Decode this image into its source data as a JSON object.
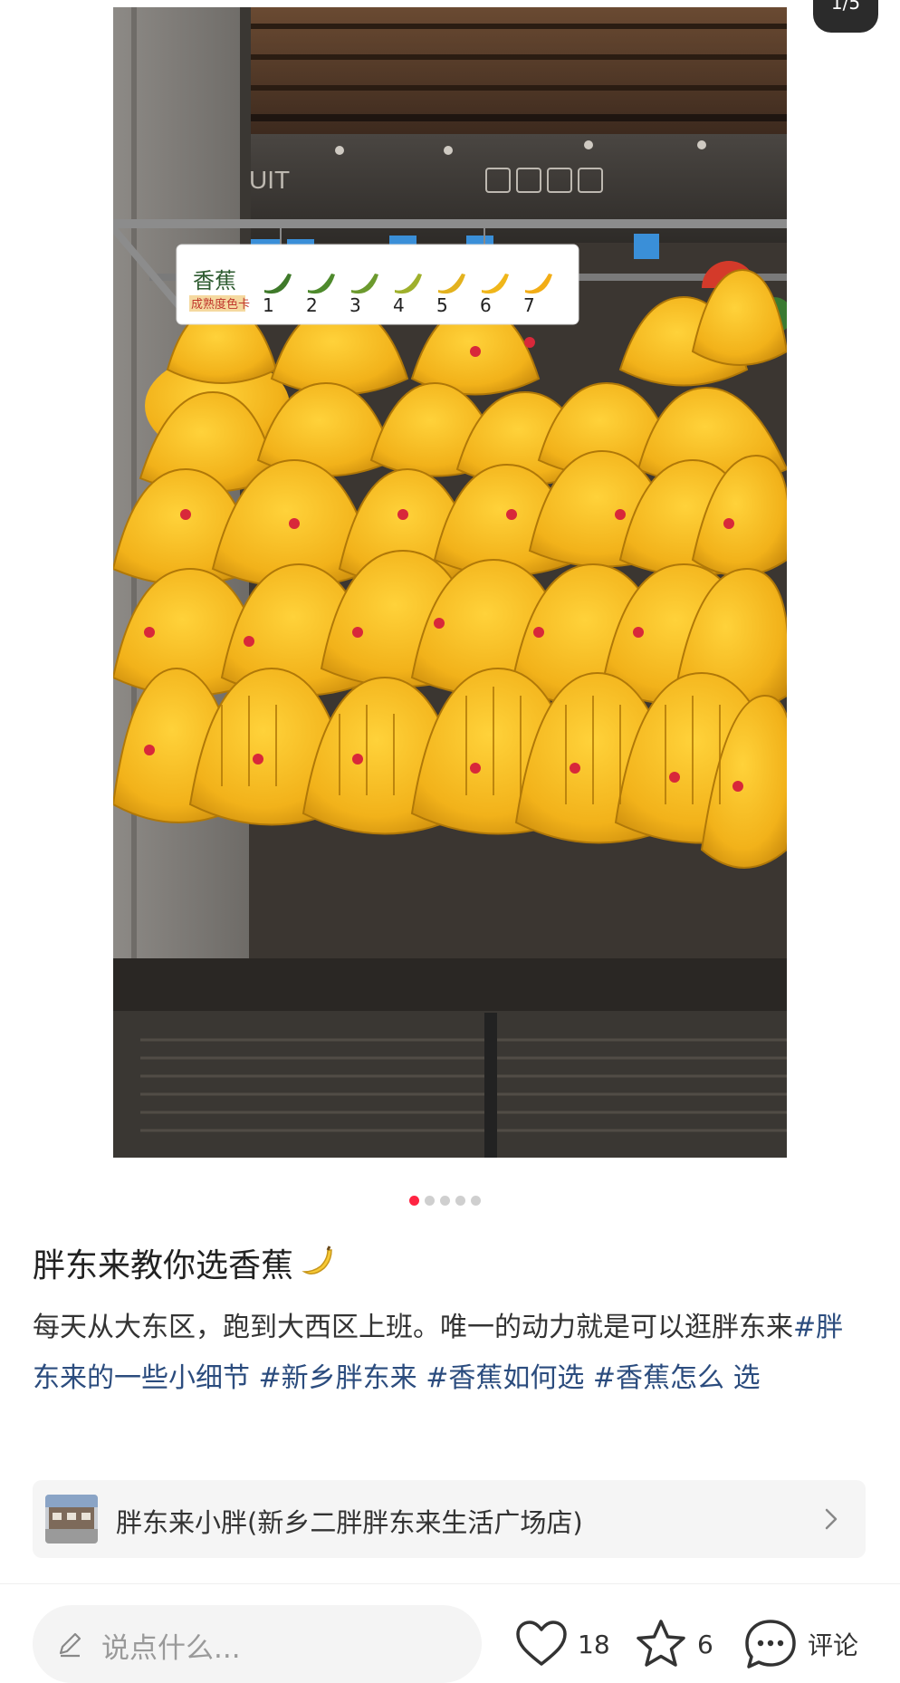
{
  "pager": {
    "counter": "1/5"
  },
  "post": {
    "title": "胖东来教你选香蕉",
    "desc_lead": "每天从大东区，跑到大西区上班。唯一的动力就是可以逛胖东来",
    "tags": [
      "#胖东来的一些小细节",
      "#新乡胖东来",
      "#香蕉如何选",
      "#香蕉怎么",
      "选"
    ]
  },
  "photo": {
    "sign_title": "香蕉",
    "sign_subtitle": "成熟度色卡",
    "stages": [
      "1",
      "2",
      "3",
      "4",
      "5",
      "6",
      "7"
    ],
    "bg_text": "UIT"
  },
  "carousel": {
    "count": 5,
    "active": 0
  },
  "location": {
    "text": "胖东来小胖(新乡二胖胖东来生活广场店)"
  },
  "bottom_bar": {
    "comment_placeholder": "说点什么...",
    "likes": "18",
    "stars": "6",
    "comment_label": "评论"
  },
  "colors": {
    "accent": "#ff2442",
    "tag": "#2b4c7e"
  }
}
